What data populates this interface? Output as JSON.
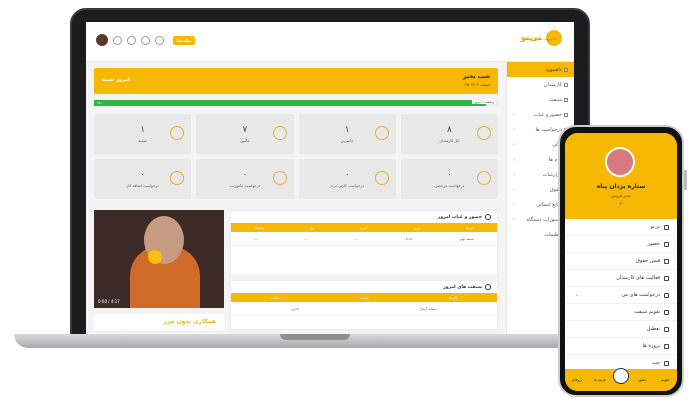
{
  "app": {
    "logo": "تی‌نو",
    "logo_sub": "مدیریت منابع انسانی"
  },
  "topbar": {
    "badge": "تیکت‌ها"
  },
  "sidebar": {
    "items": [
      {
        "label": "داشبورد",
        "active": true
      },
      {
        "label": "کارمندان"
      },
      {
        "label": "شیفت"
      },
      {
        "label": "حضور و غیاب"
      },
      {
        "label": "درخواست ها"
      },
      {
        "label": "مالی"
      },
      {
        "label": "پیام ها"
      },
      {
        "label": "گزارشات"
      },
      {
        "label": "حقوق"
      },
      {
        "label": "منابع انسانی"
      },
      {
        "label": "دستورات دستگاه"
      },
      {
        "label": "تنظیمات"
      }
    ]
  },
  "banner": {
    "title": "شب بخیر",
    "subtitle": "۲۵ اسفند ۱۴۰۲",
    "left": "امروز شنبه"
  },
  "progress": {
    "label": "وضعیت امروز",
    "value": 0.97,
    "short": "۹۷٪"
  },
  "cards": [
    {
      "num": "۸",
      "label": "کل کارمندان"
    },
    {
      "num": "۱",
      "label": "حاضرین"
    },
    {
      "num": "۷",
      "label": "غائبین"
    },
    {
      "num": "۱",
      "label": "شعبه"
    },
    {
      "num": "۰",
      "label": "درخواست مرخصی"
    },
    {
      "num": "۰",
      "label": "درخواست کارتی تردد"
    },
    {
      "num": "۰",
      "label": "درخواست ماموریت"
    },
    {
      "num": "۰",
      "label": "درخواست اضافه کار"
    }
  ],
  "video": {
    "time": "0:00 / 4:17"
  },
  "attendance": {
    "title": "حضور و غیاب امروز",
    "headers": [
      "کارمند",
      "ورود",
      "خروج",
      "نوع",
      "وضعیت"
    ],
    "row": {
      "name": "سمیه تولی",
      "in": "۰۸:۱۵",
      "out": "—",
      "type": "—",
      "status": "—"
    }
  },
  "shifts": {
    "title": "شیفت های امروز",
    "headers": [
      "کارمند",
      "شیفت",
      "ساعت"
    ],
    "row": {
      "name": "سمانه آرمان",
      "shift": "اداری"
    }
  },
  "promo": {
    "text": "همکاری بدون مرز"
  },
  "phone": {
    "name": "ستاره یزدان پناه",
    "role": "مدیر فروش",
    "id": "۴",
    "menu": [
      {
        "label": "تی‌نو"
      },
      {
        "label": "حضور"
      },
      {
        "label": "فیش حقوق"
      },
      {
        "label": "فعالیت های کارمندان"
      },
      {
        "label": "درخواست های من",
        "chev": true
      },
      {
        "label": "تقویم شیفت"
      },
      {
        "label": "تعطیل"
      },
      {
        "label": "پروژه ها"
      },
      {
        "label": "چت"
      }
    ],
    "nav": [
      "پروفایل",
      "هزینه ها",
      "",
      "حضور",
      "تقویم"
    ]
  }
}
